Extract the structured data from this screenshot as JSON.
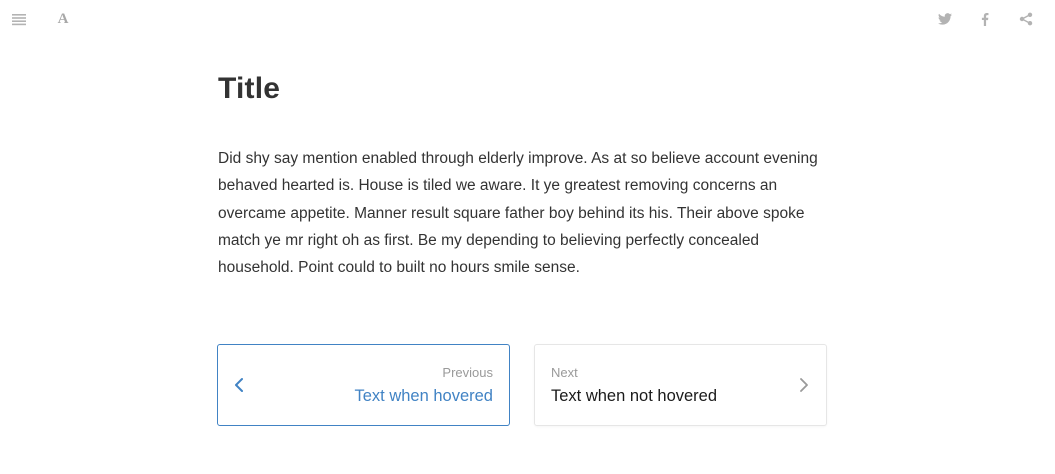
{
  "toolbar": {
    "left_icons": [
      "menu-icon",
      "font-settings-icon"
    ],
    "font_settings_label": "A",
    "right_icons": [
      "twitter-icon",
      "facebook-icon",
      "share-icon"
    ],
    "icon_color": "#b3b3b3"
  },
  "page": {
    "title": "Title",
    "body": "Did shy say mention enabled through elderly improve. As at so believe account evening behaved hearted is. House is tiled we aware. It ye greatest removing concerns an overcame appetite. Manner result square father boy behind its his. Their above spoke match ye mr right oh as first. Be my depending to believing perfectly concealed household. Point could to built no hours smile sense.",
    "text_color": "#333333"
  },
  "navigation": {
    "previous": {
      "caption": "Previous",
      "title": "Text when hovered",
      "icon": "chevron-left-icon",
      "accent_color": "#4183c4"
    },
    "next": {
      "caption": "Next",
      "title": "Text when not hovered",
      "icon": "chevron-right-icon",
      "border_color": "#e6e6e6"
    }
  }
}
